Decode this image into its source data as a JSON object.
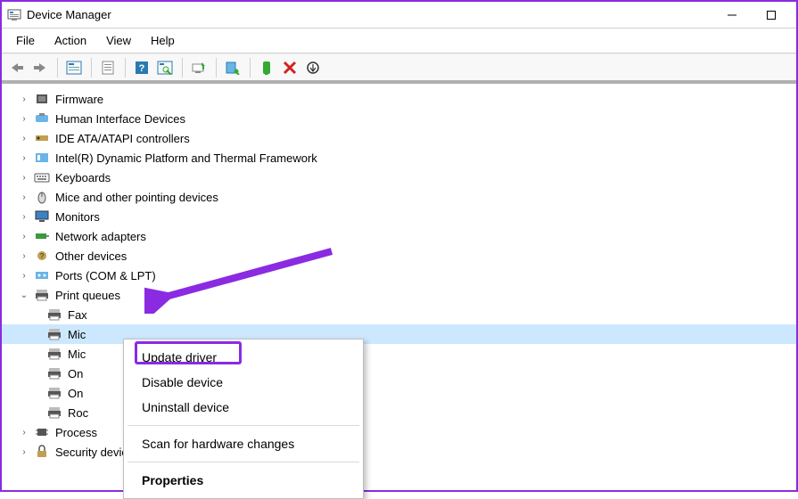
{
  "window": {
    "title": "Device Manager"
  },
  "menubar": {
    "items": [
      "File",
      "Action",
      "View",
      "Help"
    ]
  },
  "tree": {
    "nodes": [
      {
        "label": "Firmware",
        "icon": "chip",
        "expanded": false
      },
      {
        "label": "Human Interface Devices",
        "icon": "hid",
        "expanded": false
      },
      {
        "label": "IDE ATA/ATAPI controllers",
        "icon": "ide",
        "expanded": false
      },
      {
        "label": "Intel(R) Dynamic Platform and Thermal Framework",
        "icon": "thermal",
        "expanded": false
      },
      {
        "label": "Keyboards",
        "icon": "keyboard",
        "expanded": false
      },
      {
        "label": "Mice and other pointing devices",
        "icon": "mouse",
        "expanded": false
      },
      {
        "label": "Monitors",
        "icon": "monitor",
        "expanded": false
      },
      {
        "label": "Network adapters",
        "icon": "network",
        "expanded": false
      },
      {
        "label": "Other devices",
        "icon": "other",
        "expanded": false
      },
      {
        "label": "Ports (COM & LPT)",
        "icon": "ports",
        "expanded": false
      },
      {
        "label": "Print queues",
        "icon": "printer",
        "expanded": true,
        "children": [
          {
            "label": "Fax",
            "icon": "printer"
          },
          {
            "label": "Mic",
            "icon": "printer",
            "selected": true
          },
          {
            "label": "Mic",
            "icon": "printer"
          },
          {
            "label": "On",
            "icon": "printer"
          },
          {
            "label": "On",
            "icon": "printer"
          },
          {
            "label": "Roc",
            "icon": "printer"
          }
        ]
      },
      {
        "label": "Process",
        "icon": "cpu",
        "expanded": false
      },
      {
        "label": "Security devices",
        "icon": "security",
        "expanded": false
      }
    ]
  },
  "context_menu": {
    "items": [
      {
        "label": "Update driver",
        "highlighted": true
      },
      {
        "label": "Disable device"
      },
      {
        "label": "Uninstall device"
      },
      {
        "sep": true
      },
      {
        "label": "Scan for hardware changes"
      },
      {
        "sep": true
      },
      {
        "label": "Properties",
        "bold": true
      }
    ]
  }
}
